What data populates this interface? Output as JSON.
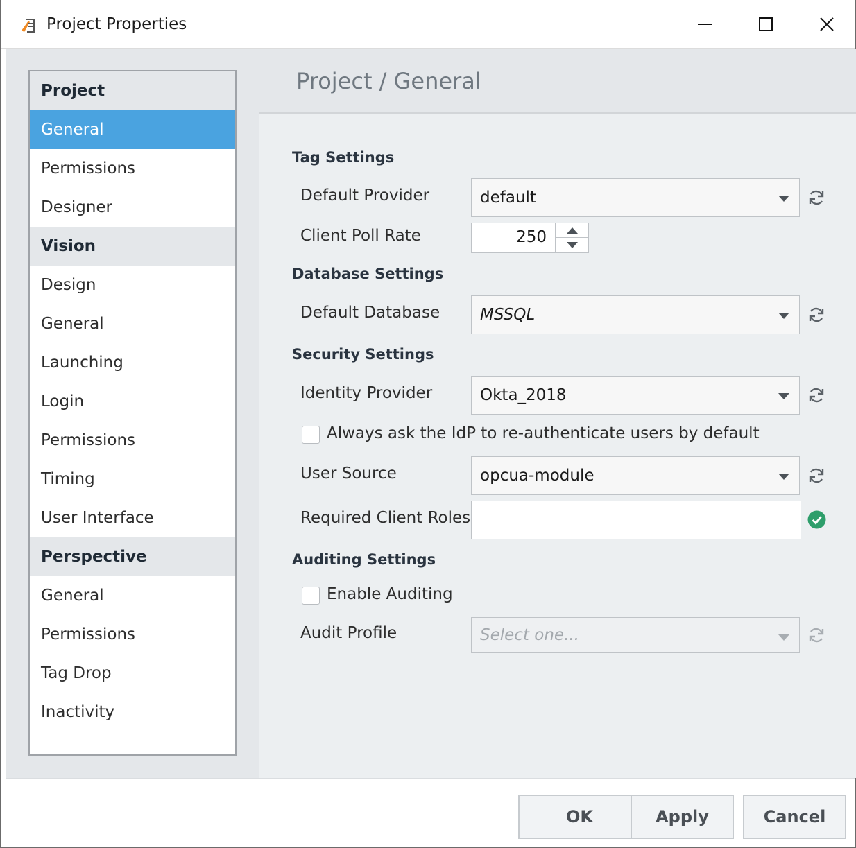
{
  "window": {
    "title": "Project Properties",
    "icon": "project-properties-icon",
    "controls": {
      "minimize": "minimize-icon",
      "maximize": "maximize-icon",
      "close": "close-icon"
    }
  },
  "sidebar": {
    "items": [
      {
        "label": "Project",
        "type": "header"
      },
      {
        "label": "General",
        "type": "item",
        "selected": true
      },
      {
        "label": "Permissions",
        "type": "item"
      },
      {
        "label": "Designer",
        "type": "item"
      },
      {
        "label": "Vision",
        "type": "header"
      },
      {
        "label": "Design",
        "type": "item"
      },
      {
        "label": "General",
        "type": "item"
      },
      {
        "label": "Launching",
        "type": "item"
      },
      {
        "label": "Login",
        "type": "item"
      },
      {
        "label": "Permissions",
        "type": "item"
      },
      {
        "label": "Timing",
        "type": "item"
      },
      {
        "label": "User Interface",
        "type": "item"
      },
      {
        "label": "Perspective",
        "type": "header"
      },
      {
        "label": "General",
        "type": "item"
      },
      {
        "label": "Permissions",
        "type": "item"
      },
      {
        "label": "Tag Drop",
        "type": "item"
      },
      {
        "label": "Inactivity",
        "type": "item"
      }
    ]
  },
  "main": {
    "title": "Project / General",
    "tag_settings": {
      "heading": "Tag Settings",
      "default_provider_label": "Default Provider",
      "default_provider_value": "default",
      "client_poll_rate_label": "Client Poll Rate",
      "client_poll_rate_value": "250"
    },
    "database_settings": {
      "heading": "Database Settings",
      "default_database_label": "Default Database",
      "default_database_value": "MSSQL"
    },
    "security_settings": {
      "heading": "Security Settings",
      "identity_provider_label": "Identity Provider",
      "identity_provider_value": "Okta_2018",
      "reauth_checkbox_label": "Always ask the IdP to re-authenticate users by default",
      "reauth_checked": false,
      "user_source_label": "User Source",
      "user_source_value": "opcua-module",
      "required_client_roles_label": "Required Client Roles",
      "required_client_roles_value": ""
    },
    "auditing_settings": {
      "heading": "Auditing Settings",
      "enable_auditing_label": "Enable Auditing",
      "enable_auditing_checked": false,
      "audit_profile_label": "Audit Profile",
      "audit_profile_placeholder": "Select one..."
    }
  },
  "footer": {
    "ok_label": "OK",
    "apply_label": "Apply",
    "cancel_label": "Cancel"
  },
  "colors": {
    "selection": "#4aa3e0",
    "panel_bg": "#e4e7ea",
    "valid_green": "#2e9e6b"
  }
}
